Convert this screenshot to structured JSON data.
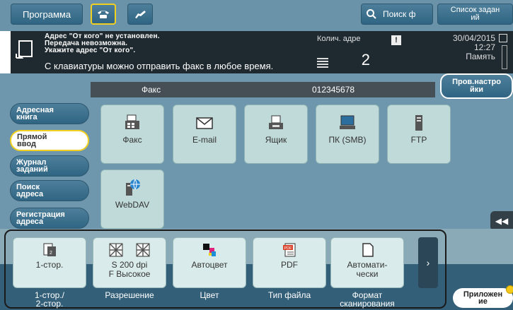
{
  "topbar": {
    "program_label": "Программа",
    "search_label": "Поиск ф",
    "jobs_label_1": "Список задан",
    "jobs_label_2": "ий"
  },
  "message": {
    "line1": "Адрес \"От кого\" не установлен.",
    "line2": "Передача невозможна.",
    "line3": "Укажите адрес \"От кого\".",
    "main": "С клавиатуры можно отправить факс в любое время."
  },
  "copies": {
    "label": "Колич. адре",
    "value": "2"
  },
  "status": {
    "date": "30/04/2015",
    "time": "12:27",
    "memory_label": "Память"
  },
  "address_bar": {
    "type": "Факс",
    "number": "012345678"
  },
  "check_settings": {
    "line1": "Пров.настро",
    "line2": "йки"
  },
  "sidebar": [
    {
      "line1": "Адресная",
      "line2": "книга"
    },
    {
      "line1": "Прямой",
      "line2": "ввод"
    },
    {
      "line1": "Журнал",
      "line2": "заданий"
    },
    {
      "line1": "Поиск",
      "line2": "адреса"
    },
    {
      "line1": "Регистрация",
      "line2": "адреса"
    }
  ],
  "destinations": [
    {
      "label": "Факс",
      "icon": "fax-icon"
    },
    {
      "label": "E-mail",
      "icon": "envelope-icon"
    },
    {
      "label": "Ящик",
      "icon": "box-icon"
    },
    {
      "label": "ПК (SMB)",
      "icon": "pc-icon"
    },
    {
      "label": "FTP",
      "icon": "ftp-server-icon"
    },
    {
      "label": "WebDAV",
      "icon": "webdav-icon"
    }
  ],
  "settings": [
    {
      "value1": "1-стор.",
      "value2": "",
      "caption1": "1-стор./",
      "caption2": "2-стор.",
      "icon": "simplex-icon"
    },
    {
      "value1": "S 200 dpi",
      "value2": "F Высокое",
      "caption1": "Разрешение",
      "caption2": "",
      "icon": "resolution-icon"
    },
    {
      "value1": "Автоцвет",
      "value2": "",
      "caption1": "Цвет",
      "caption2": "",
      "icon": "color-icon"
    },
    {
      "value1": "PDF",
      "value2": "",
      "caption1": "Тип файла",
      "caption2": "",
      "icon": "pdf-icon"
    },
    {
      "value1": "Автомати-",
      "value2": "чески",
      "caption1": "Формат",
      "caption2": "сканирования",
      "icon": "page-icon"
    }
  ],
  "app_button": {
    "line1": "Приложен",
    "line2": "ие"
  },
  "colors": {
    "accent_yellow": "#f2d020",
    "panel_dark": "#1f2a30",
    "main_bg": "#6e96ad"
  }
}
